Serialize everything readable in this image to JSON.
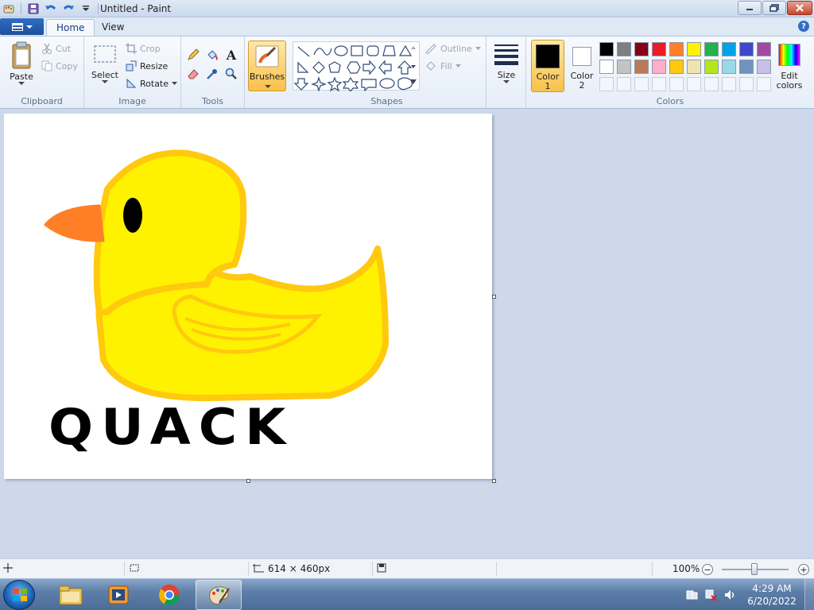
{
  "window": {
    "title": "Untitled - Paint"
  },
  "tabs": {
    "home": "Home",
    "view": "View"
  },
  "ribbon": {
    "clipboard": {
      "label": "Clipboard",
      "paste": "Paste",
      "cut": "Cut",
      "copy": "Copy"
    },
    "image": {
      "label": "Image",
      "select": "Select",
      "crop": "Crop",
      "resize": "Resize",
      "rotate": "Rotate"
    },
    "tools": {
      "label": "Tools"
    },
    "brushes": {
      "label": "Brushes"
    },
    "shapes": {
      "label": "Shapes",
      "outline": "Outline",
      "fill": "Fill"
    },
    "size": {
      "label": "Size"
    },
    "colors": {
      "label": "Colors",
      "color1_line1": "Color",
      "color1_line2": "1",
      "color2_line1": "Color",
      "color2_line2": "2",
      "edit_line1": "Edit",
      "edit_line2": "colors",
      "color1_value": "#000000",
      "color2_value": "#ffffff",
      "palette": [
        "#000000",
        "#7f7f7f",
        "#880015",
        "#ed1c24",
        "#ff7f27",
        "#fff200",
        "#22b14c",
        "#00a2e8",
        "#3f48cc",
        "#a349a4",
        "#ffffff",
        "#c3c3c3",
        "#b97a57",
        "#ffaec9",
        "#ffc90e",
        "#efe4b0",
        "#b5e61d",
        "#99d9ea",
        "#7092be",
        "#c8bfe7",
        "",
        "",
        "",
        "",
        "",
        "",
        "",
        "",
        "",
        ""
      ]
    }
  },
  "canvas": {
    "drawing_text": "QUACK",
    "accent": {
      "duck_fill": "#fff200",
      "duck_outline": "#ffc90e",
      "beak": "#ff7f27"
    }
  },
  "statusbar": {
    "dimensions": "614 × 460px",
    "zoom": "100%"
  },
  "taskbar": {
    "time": "4:29 AM",
    "date": "6/20/2022"
  }
}
